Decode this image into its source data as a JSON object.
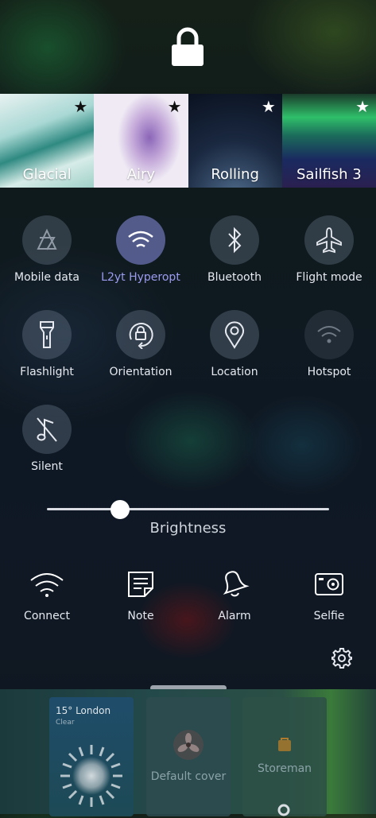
{
  "lockscreen": {
    "lock_icon": "lock-icon"
  },
  "ambiences": [
    {
      "name": "Glacial",
      "favorite": true
    },
    {
      "name": "Airy",
      "favorite": true
    },
    {
      "name": "Rolling",
      "favorite": true
    },
    {
      "name": "Sailfish 3",
      "favorite": true
    }
  ],
  "quick_toggles": [
    {
      "label": "Mobile data",
      "icon": "mobile-data-icon",
      "state": "off"
    },
    {
      "label": "L2yt Hyperopt",
      "icon": "wifi-icon",
      "state": "on"
    },
    {
      "label": "Bluetooth",
      "icon": "bluetooth-icon",
      "state": "off"
    },
    {
      "label": "Flight mode",
      "icon": "airplane-icon",
      "state": "off"
    },
    {
      "label": "Flashlight",
      "icon": "flashlight-icon",
      "state": "off"
    },
    {
      "label": "Orientation",
      "icon": "orientation-lock-icon",
      "state": "off"
    },
    {
      "label": "Location",
      "icon": "location-icon",
      "state": "off"
    },
    {
      "label": "Hotspot",
      "icon": "hotspot-icon",
      "state": "disabled"
    },
    {
      "label": "Silent",
      "icon": "silent-icon",
      "state": "off"
    }
  ],
  "brightness": {
    "label": "Brightness",
    "level_percent": 26
  },
  "shortcuts": [
    {
      "label": "Connect",
      "icon": "wifi-connect-icon"
    },
    {
      "label": "Note",
      "icon": "note-icon"
    },
    {
      "label": "Alarm",
      "icon": "alarm-bell-icon"
    },
    {
      "label": "Selfie",
      "icon": "camera-icon"
    }
  ],
  "settings": {
    "icon": "gear-icon"
  },
  "covers": {
    "weather": {
      "city": "15° London",
      "condition": "Clear"
    },
    "default": {
      "label": "Default cover"
    },
    "store": {
      "label": "Storeman"
    }
  },
  "colors": {
    "accent": "#9b9cf0",
    "active_toggle": "#8c91e6"
  }
}
